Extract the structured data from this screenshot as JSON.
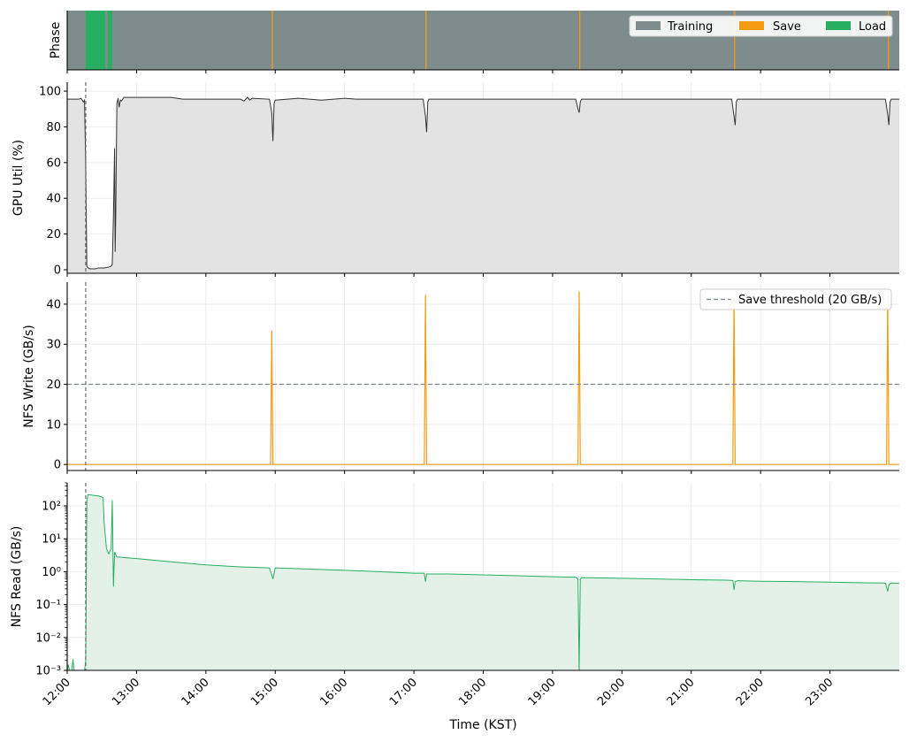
{
  "colors": {
    "training": "#7f8c8d",
    "save": "#f39c12",
    "load": "#27ae60",
    "gpu_line": "#333333",
    "gpu_fill": "#e3e3e3",
    "nfs_read_line": "#27ae60",
    "nfs_read_fill": "#e3f1e8",
    "threshold": "#7f8c8d",
    "grid": "#e8e8e8"
  },
  "chart_data": [
    {
      "type": "timeline",
      "ylabel": "Phase",
      "legend": {
        "position": "top-right",
        "items": [
          "Training",
          "Save",
          "Load"
        ]
      },
      "background_phase": "Training",
      "segments": [
        {
          "phase": "Load",
          "start": "12:16",
          "end": "12:33"
        },
        {
          "phase": "Load",
          "start": "12:35",
          "end": "12:39"
        },
        {
          "phase": "Save",
          "start": "14:57",
          "end": "14:58"
        },
        {
          "phase": "Save",
          "start": "17:10",
          "end": "17:11"
        },
        {
          "phase": "Save",
          "start": "19:23",
          "end": "19:24"
        },
        {
          "phase": "Save",
          "start": "21:37",
          "end": "21:38"
        },
        {
          "phase": "Save",
          "start": "23:50",
          "end": "23:51"
        }
      ]
    },
    {
      "type": "area",
      "ylabel": "GPU Util (%)",
      "ylim": [
        -2,
        105
      ],
      "yticks": [
        0,
        20,
        40,
        60,
        80,
        100
      ],
      "grid": true,
      "vline": "12:16",
      "points": [
        [
          "12:00",
          95.5
        ],
        [
          "12:10",
          95.5
        ],
        [
          "12:12",
          96
        ],
        [
          "12:14",
          94
        ],
        [
          "12:15",
          95
        ],
        [
          "12:16",
          60
        ],
        [
          "12:17",
          2
        ],
        [
          "12:18",
          1
        ],
        [
          "12:20",
          0.5
        ],
        [
          "12:24",
          0.5
        ],
        [
          "12:27",
          1
        ],
        [
          "12:32",
          1
        ],
        [
          "12:36",
          1.5
        ],
        [
          "12:38",
          2
        ],
        [
          "12:39",
          3
        ],
        [
          "12:40",
          30
        ],
        [
          "12:41",
          68
        ],
        [
          "12:41.5",
          10
        ],
        [
          "12:42",
          30
        ],
        [
          "12:43",
          93
        ],
        [
          "12:44",
          96
        ],
        [
          "12:45",
          91
        ],
        [
          "12:46",
          95
        ],
        [
          "12:47",
          94.5
        ],
        [
          "12:49",
          96.5
        ],
        [
          "13:30",
          96.5
        ],
        [
          "13:40",
          95.5
        ],
        [
          "14:30",
          95.5
        ],
        [
          "14:33",
          94.5
        ],
        [
          "14:36",
          96.5
        ],
        [
          "14:38",
          95
        ],
        [
          "14:40",
          96
        ],
        [
          "14:55",
          95.5
        ],
        [
          "14:57",
          88
        ],
        [
          "14:58",
          72
        ],
        [
          "14:59",
          93
        ],
        [
          "15:00",
          95
        ],
        [
          "15:20",
          96
        ],
        [
          "15:40",
          95
        ],
        [
          "16:00",
          96
        ],
        [
          "16:10",
          95.5
        ],
        [
          "17:08",
          95.5
        ],
        [
          "17:10",
          86
        ],
        [
          "17:11",
          77
        ],
        [
          "17:12",
          94
        ],
        [
          "17:13",
          95.5
        ],
        [
          "19:20",
          95.5
        ],
        [
          "19:22",
          90
        ],
        [
          "19:23",
          88
        ],
        [
          "19:24",
          94
        ],
        [
          "19:25",
          95.5
        ],
        [
          "21:35",
          95.5
        ],
        [
          "21:37",
          86
        ],
        [
          "21:38",
          81
        ],
        [
          "21:39",
          94
        ],
        [
          "21:40",
          95.5
        ],
        [
          "23:48",
          95.5
        ],
        [
          "23:50",
          87
        ],
        [
          "23:51",
          81
        ],
        [
          "23:52",
          94
        ],
        [
          "23:53",
          95.5
        ],
        [
          "24:00",
          95.5
        ]
      ]
    },
    {
      "type": "line",
      "ylabel": "NFS Write (GB/s)",
      "ylim": [
        -1.5,
        45.5
      ],
      "yticks": [
        0,
        10,
        20,
        30,
        40
      ],
      "grid": true,
      "vline": "12:16",
      "legend": {
        "position": "top-right",
        "items": [
          "Save threshold (20 GB/s)"
        ]
      },
      "threshold": 20,
      "points": [
        [
          "12:00",
          0
        ],
        [
          "14:56",
          0
        ],
        [
          "14:57",
          33.4
        ],
        [
          "14:58",
          0
        ],
        [
          "17:09",
          0
        ],
        [
          "17:10",
          42.3
        ],
        [
          "17:11",
          0
        ],
        [
          "19:22",
          0
        ],
        [
          "19:23",
          43.2
        ],
        [
          "19:24",
          0
        ],
        [
          "21:36",
          0
        ],
        [
          "21:37",
          42
        ],
        [
          "21:38",
          0
        ],
        [
          "23:49",
          0
        ],
        [
          "23:50",
          42
        ],
        [
          "23:51",
          0
        ],
        [
          "24:00",
          0
        ]
      ]
    },
    {
      "type": "area",
      "ylabel": "NFS Read (GB/s)",
      "yscale": "log",
      "ylim": [
        0.001,
        500
      ],
      "yticks": [
        0.001,
        0.01,
        0.1,
        1,
        10,
        100
      ],
      "ytick_labels": [
        "10⁻³",
        "10⁻²",
        "10⁻¹",
        "10⁰",
        "10¹",
        "10²"
      ],
      "grid": true,
      "vline": "12:16",
      "points": [
        [
          "12:00",
          0.001
        ],
        [
          "12:01",
          0.0015
        ],
        [
          "12:02",
          0.001
        ],
        [
          "12:04",
          0.001
        ],
        [
          "12:05",
          0.0022
        ],
        [
          "12:06",
          0.001
        ],
        [
          "12:15",
          0.001
        ],
        [
          "12:16",
          0.002
        ],
        [
          "12:17",
          150
        ],
        [
          "12:18",
          220
        ],
        [
          "12:22",
          210
        ],
        [
          "12:27",
          200
        ],
        [
          "12:31",
          180
        ],
        [
          "12:32",
          30
        ],
        [
          "12:34",
          5
        ],
        [
          "12:36",
          3.5
        ],
        [
          "12:38",
          5
        ],
        [
          "12:39",
          150
        ],
        [
          "12:40",
          0.35
        ],
        [
          "12:41",
          4
        ],
        [
          "12:43",
          2.8
        ],
        [
          "13:00",
          2.5
        ],
        [
          "13:30",
          2
        ],
        [
          "14:00",
          1.6
        ],
        [
          "14:30",
          1.4
        ],
        [
          "14:55",
          1.3
        ],
        [
          "14:57",
          0.8
        ],
        [
          "14:58",
          0.6
        ],
        [
          "15:00",
          1.3
        ],
        [
          "15:30",
          1.2
        ],
        [
          "16:00",
          1.1
        ],
        [
          "16:30",
          1
        ],
        [
          "17:00",
          0.9
        ],
        [
          "17:09",
          0.9
        ],
        [
          "17:10",
          0.5
        ],
        [
          "17:11",
          0.85
        ],
        [
          "17:30",
          0.85
        ],
        [
          "18:00",
          0.8
        ],
        [
          "18:30",
          0.75
        ],
        [
          "19:00",
          0.7
        ],
        [
          "19:20",
          0.68
        ],
        [
          "19:22",
          0.6
        ],
        [
          "19:23",
          0.001
        ],
        [
          "19:24",
          0.6
        ],
        [
          "19:25",
          0.66
        ],
        [
          "20:00",
          0.63
        ],
        [
          "20:30",
          0.6
        ],
        [
          "21:00",
          0.57
        ],
        [
          "21:30",
          0.55
        ],
        [
          "21:36",
          0.54
        ],
        [
          "21:37",
          0.28
        ],
        [
          "21:38",
          0.5
        ],
        [
          "21:40",
          0.53
        ],
        [
          "22:00",
          0.51
        ],
        [
          "22:30",
          0.5
        ],
        [
          "23:00",
          0.48
        ],
        [
          "23:30",
          0.46
        ],
        [
          "23:48",
          0.45
        ],
        [
          "23:50",
          0.25
        ],
        [
          "23:51",
          0.4
        ],
        [
          "23:53",
          0.45
        ],
        [
          "24:00",
          0.44
        ]
      ]
    }
  ],
  "x_axis": {
    "label": "Time (KST)",
    "range": [
      "12:00",
      "24:00"
    ],
    "ticks": [
      "12:00",
      "13:00",
      "14:00",
      "15:00",
      "16:00",
      "17:00",
      "18:00",
      "19:00",
      "20:00",
      "21:00",
      "22:00",
      "23:00"
    ]
  }
}
